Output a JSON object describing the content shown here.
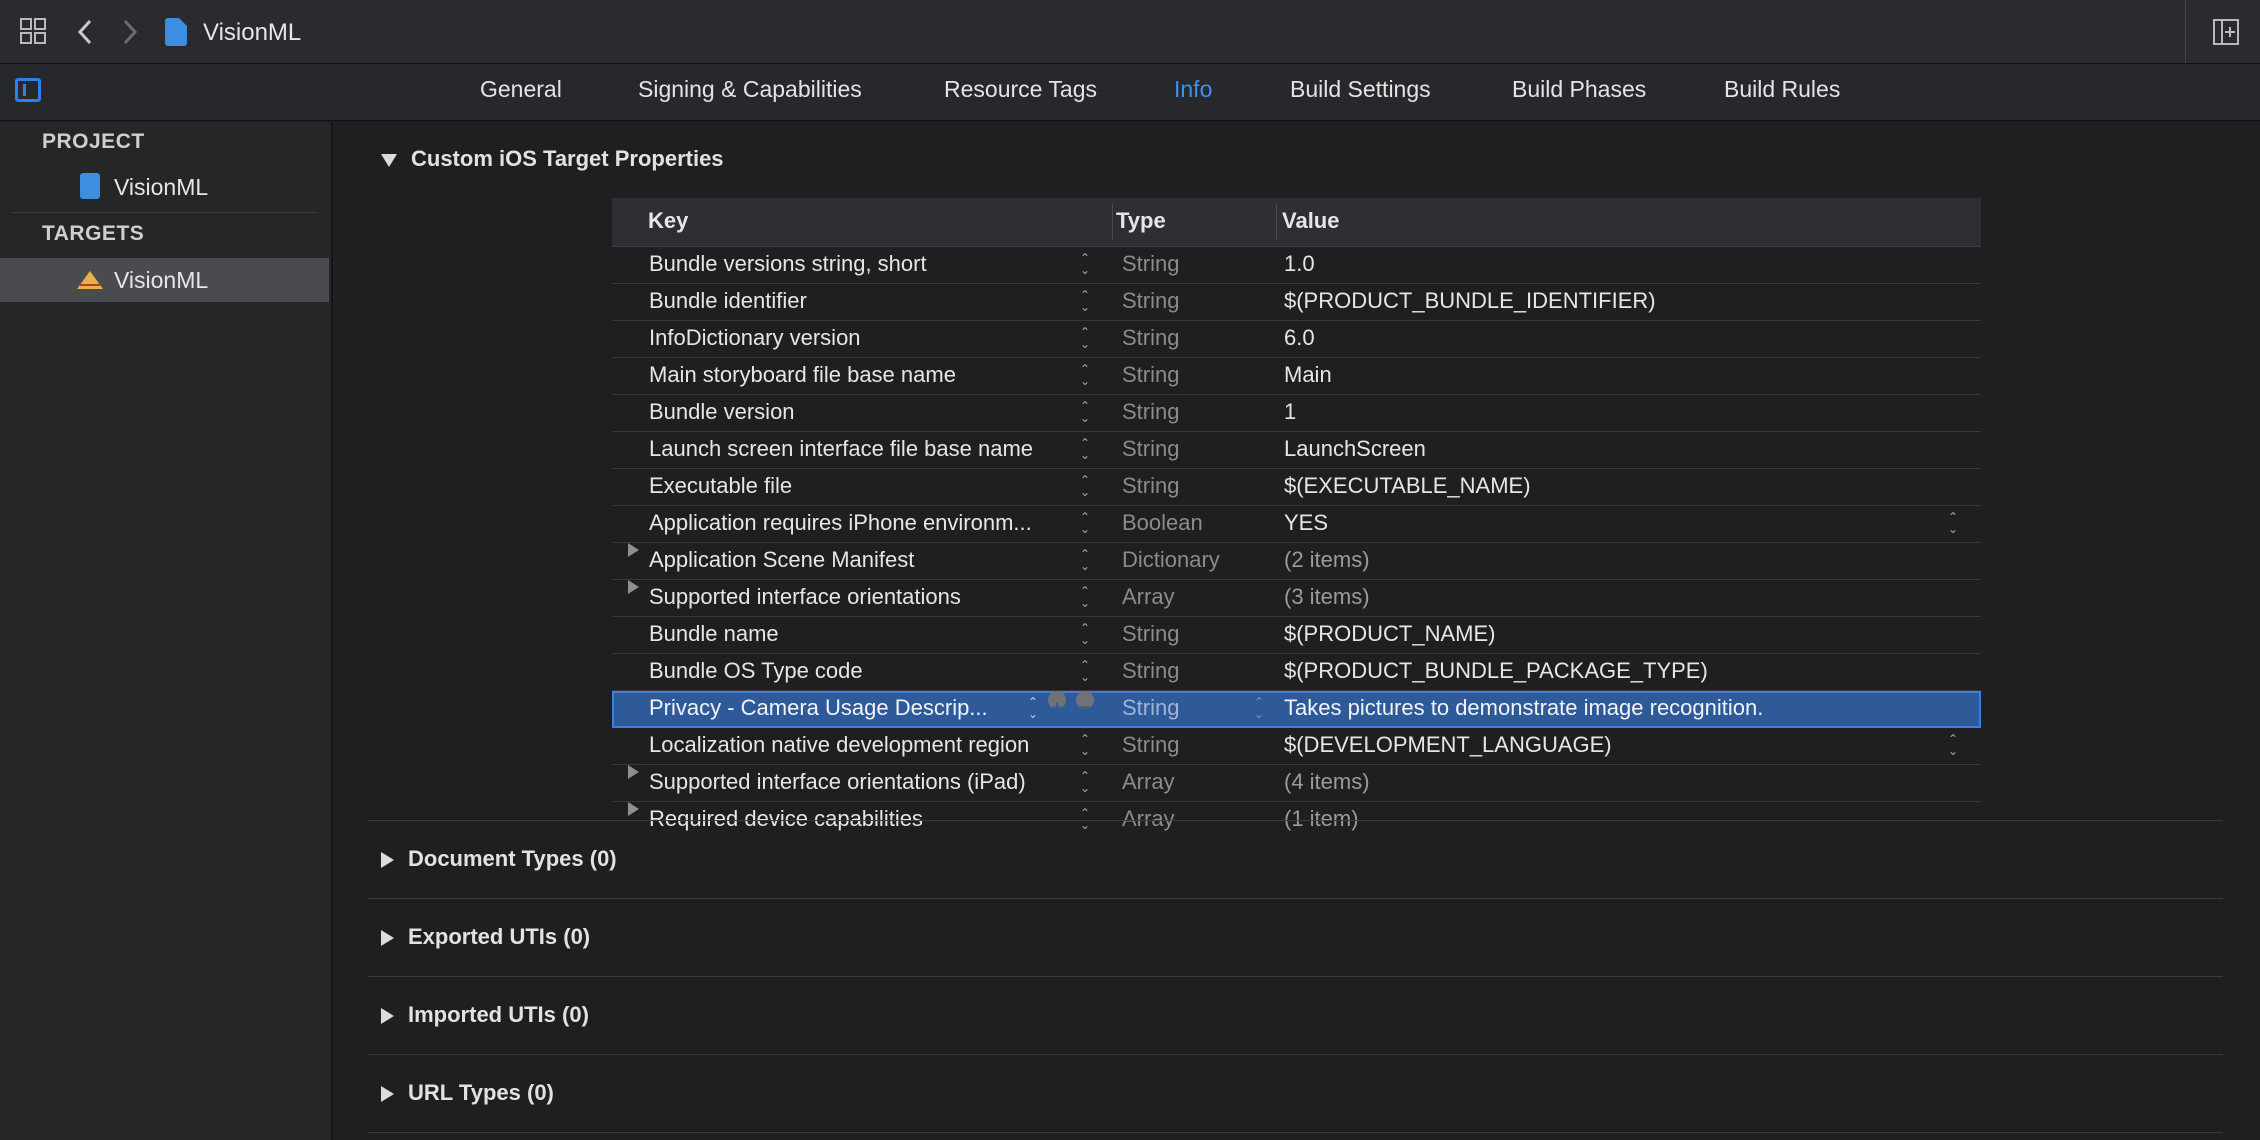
{
  "window": {
    "breadcrumb": "VisionML"
  },
  "tabs": [
    {
      "label": "General",
      "active": false
    },
    {
      "label": "Signing & Capabilities",
      "active": false
    },
    {
      "label": "Resource Tags",
      "active": false
    },
    {
      "label": "Info",
      "active": true
    },
    {
      "label": "Build Settings",
      "active": false
    },
    {
      "label": "Build Phases",
      "active": false
    },
    {
      "label": "Build Rules",
      "active": false
    }
  ],
  "sidebar": {
    "project_header": "PROJECT",
    "project_item": "VisionML",
    "targets_header": "TARGETS",
    "target_item": "VisionML"
  },
  "properties": {
    "title": "Custom iOS Target Properties",
    "columns": {
      "key": "Key",
      "type": "Type",
      "value": "Value"
    },
    "rows": [
      {
        "key": "Bundle versions string, short",
        "type": "String",
        "value": "1.0"
      },
      {
        "key": "Bundle identifier",
        "type": "String",
        "value": "$(PRODUCT_BUNDLE_IDENTIFIER)"
      },
      {
        "key": "InfoDictionary version",
        "type": "String",
        "value": "6.0"
      },
      {
        "key": "Main storyboard file base name",
        "type": "String",
        "value": "Main"
      },
      {
        "key": "Bundle version",
        "type": "String",
        "value": "1"
      },
      {
        "key": "Launch screen interface file base name",
        "type": "String",
        "value": "LaunchScreen"
      },
      {
        "key": "Executable file",
        "type": "String",
        "value": "$(EXECUTABLE_NAME)"
      },
      {
        "key": "Application requires iPhone environm...",
        "type": "Boolean",
        "value": "YES"
      },
      {
        "key": "Application Scene Manifest",
        "type": "Dictionary",
        "value": "(2 items)"
      },
      {
        "key": "Supported interface orientations",
        "type": "Array",
        "value": "(3 items)"
      },
      {
        "key": "Bundle name",
        "type": "String",
        "value": "$(PRODUCT_NAME)"
      },
      {
        "key": "Bundle OS Type code",
        "type": "String",
        "value": "$(PRODUCT_BUNDLE_PACKAGE_TYPE)"
      },
      {
        "key": "Privacy - Camera Usage Descrip...",
        "type": "String",
        "value": "Takes pictures to demonstrate image recognition."
      },
      {
        "key": "Localization native development region",
        "type": "String",
        "value": "$(DEVELOPMENT_LANGUAGE)"
      },
      {
        "key": "Supported interface orientations (iPad)",
        "type": "Array",
        "value": "(4 items)"
      },
      {
        "key": "Required device capabilities",
        "type": "Array",
        "value": "(1 item)"
      }
    ]
  },
  "sections": {
    "document_types": "Document Types (0)",
    "exported_utis": "Exported UTIs (0)",
    "imported_utis": "Imported UTIs (0)",
    "url_types": "URL Types (0)"
  },
  "colors": {
    "accent": "#3d8ff0",
    "selection": "#2e5a9a",
    "background": "#1e1f21"
  }
}
